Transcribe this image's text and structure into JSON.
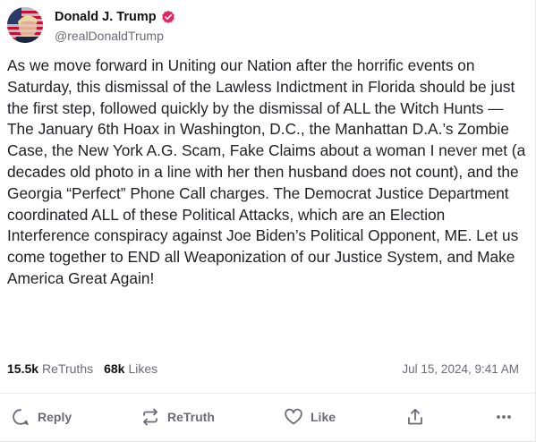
{
  "post": {
    "author": {
      "display_name": "Donald J. Trump",
      "handle": "@realDonaldTrump",
      "verified": true
    },
    "text": "As we move forward in Uniting our Nation after the horrific events on Saturday, this dismissal of the Lawless Indictment in Florida should be just the first step, followed quickly by the dismissal of ALL the Witch Hunts — The January 6th Hoax in Washington, D.C., the Manhattan D.A.’s Zombie Case, the New York A.G. Scam, Fake Claims about a woman I never met (a decades old photo in a line with her then husband does not count), and the Georgia “Perfect” Phone Call charges. The Democrat Justice Department coordinated ALL of these Political Attacks, which are an Election Interference conspiracy against Joe Biden’s Political Opponent, ME. Let us come together to END all Weaponization of our Justice System, and Make America Great Again!",
    "stats": {
      "retruths_count": "15.5k",
      "retruths_label": "ReTruths",
      "likes_count": "68k",
      "likes_label": "Likes"
    },
    "timestamp": "Jul 15, 2024, 9:41 AM"
  },
  "actions": {
    "reply_label": "Reply",
    "retruth_label": "ReTruth",
    "like_label": "Like",
    "share_icon": "share-icon",
    "more_icon": "more-icon"
  },
  "colors": {
    "verified": "#e5245e",
    "muted": "#6b6b76",
    "text": "#1f1f24"
  }
}
